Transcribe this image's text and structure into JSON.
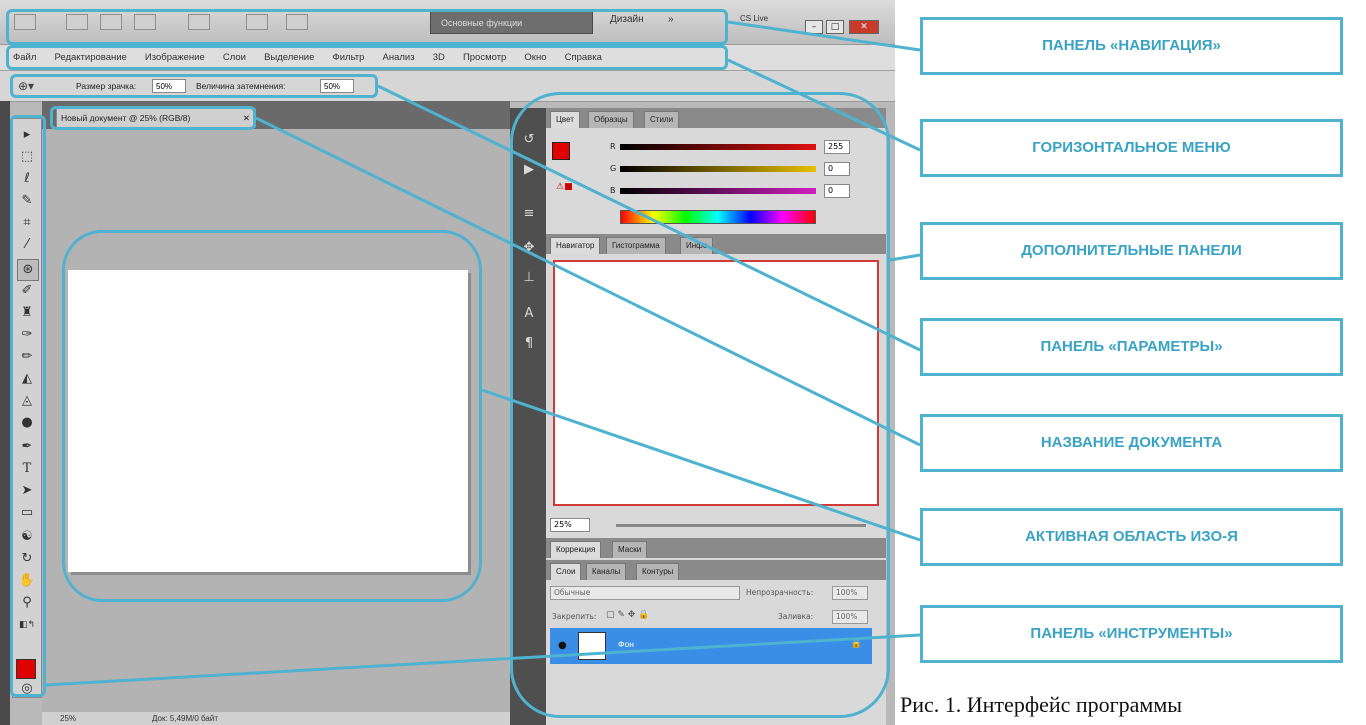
{
  "window": {
    "workspace_label": "Основные функции",
    "design_label": "Дизайн",
    "more_label": "»",
    "cs_label": "CS Live",
    "minimize": "–",
    "maximize": "□",
    "close": "✕"
  },
  "menu": [
    "Файл",
    "Редактирование",
    "Изображение",
    "Слои",
    "Выделение",
    "Фильтр",
    "Анализ",
    "3D",
    "Просмотр",
    "Окно",
    "Справка"
  ],
  "options": {
    "size_label": "Размер зрачка:",
    "size_value": "50%",
    "darken_label": "Величина затемнения:",
    "darken_value": "50%"
  },
  "document": {
    "tab_title": "Новый документ @ 25% (RGB/8)",
    "tab_close": "✕",
    "zoom": "25%",
    "doc_info": "Док: 5,49M/0 байт"
  },
  "color_panel": {
    "tabs": [
      "Цвет",
      "Образцы",
      "Стили"
    ],
    "channels": [
      {
        "label": "R",
        "value": "255",
        "color": "#e01010"
      },
      {
        "label": "G",
        "value": "0",
        "color": "#e8c000"
      },
      {
        "label": "B",
        "value": "0",
        "color": "#d020c0"
      }
    ]
  },
  "navigator_panel": {
    "tabs": [
      "Навигатор",
      "Гистограмма",
      "Инфо"
    ],
    "zoom": "25%"
  },
  "adjust_panel": {
    "tabs": [
      "Коррекция",
      "Маски"
    ]
  },
  "layers_panel": {
    "tabs": [
      "Слои",
      "Каналы",
      "Контуры"
    ],
    "blend_mode": "Обычные",
    "opacity_label": "Непрозрачность:",
    "opacity_value": "100%",
    "lock_label": "Закрепить:",
    "fill_label": "Заливка:",
    "fill_value": "100%",
    "layer_name": "Фон"
  },
  "colors": {
    "highlight": "#4fb2cf",
    "foreground": "#e00000",
    "layer_selected": "#3a8ee6"
  },
  "callouts": [
    "ПАНЕЛЬ «НАВИГАЦИЯ»",
    "ГОРИЗОНТАЛЬНОЕ МЕНЮ",
    "ДОПОЛНИТЕЛЬНЫЕ ПАНЕЛИ",
    "ПАНЕЛЬ «ПАРАМЕТРЫ»",
    "НАЗВАНИЕ ДОКУМЕНТА",
    "АКТИВНАЯ ОБЛАСТЬ ИЗО-Я",
    "ПАНЕЛЬ «ИНСТРУМЕНТЫ»"
  ],
  "caption": "Рис. 1. Интерфейс программы"
}
